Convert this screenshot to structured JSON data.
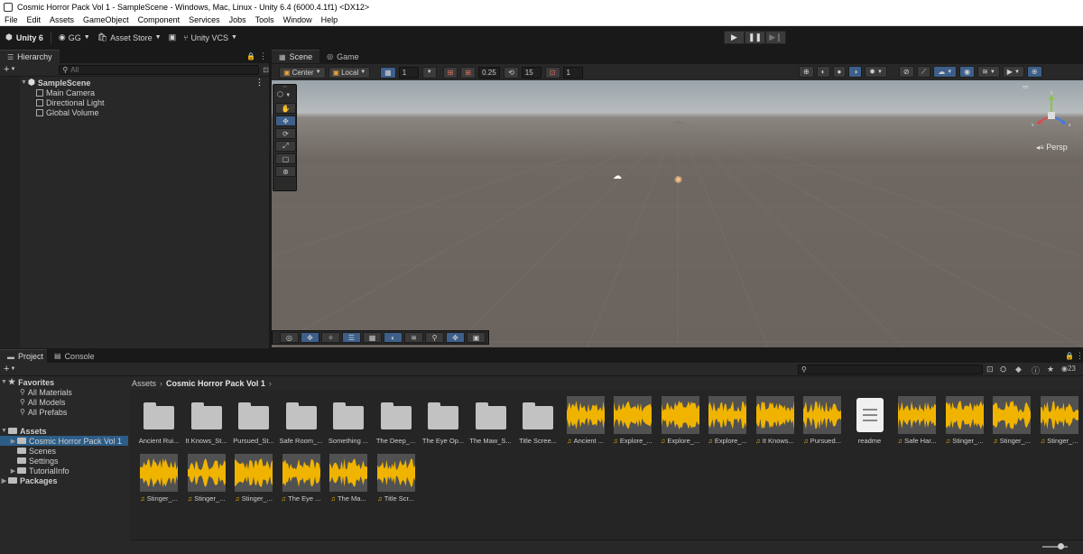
{
  "window": {
    "title": "Cosmic Horror Pack Vol 1 - SampleScene - Windows, Mac, Linux - Unity 6.4 (6000.4.1f1) <DX12>"
  },
  "menu": [
    "File",
    "Edit",
    "Assets",
    "GameObject",
    "Component",
    "Services",
    "Jobs",
    "Tools",
    "Window",
    "Help"
  ],
  "toolbar": {
    "unity_label": "Unity 6",
    "account_label": "GG",
    "asset_store_label": "Asset Store",
    "vcs_label": "Unity VCS"
  },
  "hierarchy": {
    "tab_label": "Hierarchy",
    "search_placeholder": "All",
    "scene_name": "SampleScene",
    "objects": [
      "Main Camera",
      "Directional Light",
      "Global Volume"
    ]
  },
  "scene_tabs": {
    "scene_label": "Scene",
    "game_label": "Game"
  },
  "scene_toolbar": {
    "pivot_label": "Center",
    "space_label": "Local",
    "grid_value": "1",
    "snap_value": "0.25",
    "rotate_snap_value": "15",
    "scale_snap_value": "1",
    "projection_label": "Persp"
  },
  "project": {
    "tab_label": "Project",
    "console_label": "Console",
    "hidden_count": "23",
    "breadcrumb": [
      "Assets",
      "Cosmic Horror Pack Vol 1"
    ],
    "favorites_label": "Favorites",
    "favorites": [
      "All Materials",
      "All Models",
      "All Prefabs"
    ],
    "assets_label": "Assets",
    "asset_folders": [
      "Cosmic Horror Pack Vol 1",
      "Scenes",
      "Settings",
      "TutorialInfo"
    ],
    "packages_label": "Packages",
    "items": [
      {
        "label": "Ancient Rui...",
        "kind": "folder"
      },
      {
        "label": "It Knows_St...",
        "kind": "folder"
      },
      {
        "label": "Pursued_St...",
        "kind": "folder"
      },
      {
        "label": "Safe Room_...",
        "kind": "folder"
      },
      {
        "label": "Something ...",
        "kind": "folder"
      },
      {
        "label": "The Deep_...",
        "kind": "folder"
      },
      {
        "label": "The Eye Op...",
        "kind": "folder"
      },
      {
        "label": "The Maw_S...",
        "kind": "folder"
      },
      {
        "label": "Title Scree...",
        "kind": "folder"
      },
      {
        "label": "Ancient ...",
        "kind": "audio"
      },
      {
        "label": "Explore_...",
        "kind": "audio"
      },
      {
        "label": "Explore_...",
        "kind": "audio"
      },
      {
        "label": "Explore_...",
        "kind": "audio"
      },
      {
        "label": "It Knows...",
        "kind": "audio"
      },
      {
        "label": "Pursued...",
        "kind": "audio"
      },
      {
        "label": "readme",
        "kind": "doc"
      },
      {
        "label": "Safe Har...",
        "kind": "audio"
      },
      {
        "label": "Stinger_...",
        "kind": "audio"
      },
      {
        "label": "Stinger_...",
        "kind": "audio"
      },
      {
        "label": "Stinger_...",
        "kind": "audio"
      },
      {
        "label": "Stinger_...",
        "kind": "audio"
      },
      {
        "label": "Stinger_...",
        "kind": "audio"
      },
      {
        "label": "Stinger_...",
        "kind": "audio"
      },
      {
        "label": "The Eye ...",
        "kind": "audio"
      },
      {
        "label": "The Ma...",
        "kind": "audio"
      },
      {
        "label": "Title Scr...",
        "kind": "audio"
      }
    ]
  },
  "colors": {
    "accent": "#2c5d87",
    "audio_wave": "#f0b400"
  }
}
